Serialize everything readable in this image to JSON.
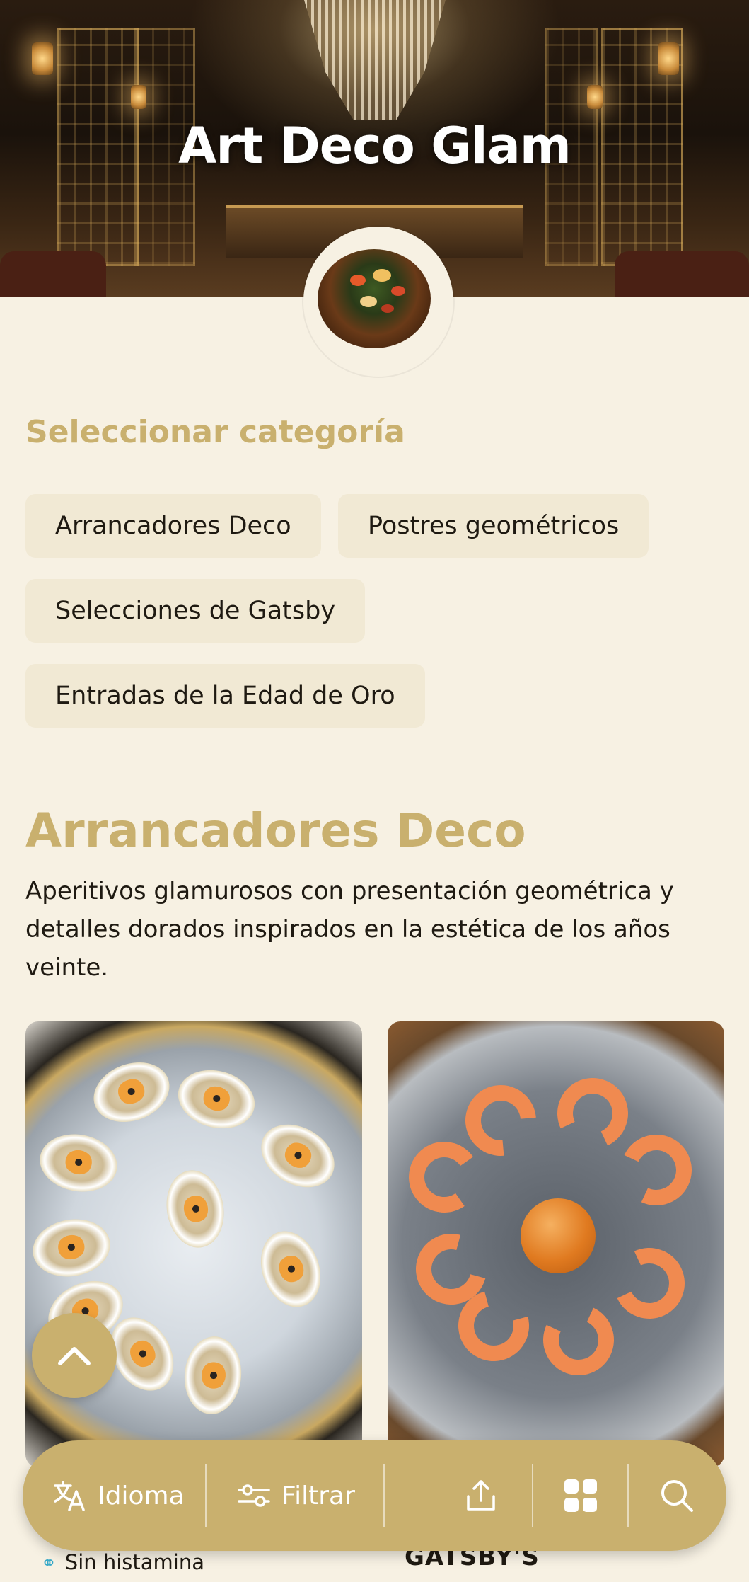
{
  "restaurant": {
    "name": "Art Deco Glam"
  },
  "categories": {
    "heading": "Seleccionar categoría",
    "items": [
      "Arrancadores Deco",
      "Postres geométricos",
      "Selecciones de Gatsby",
      "Entradas de la Edad de Oro"
    ]
  },
  "section": {
    "title": "Arrancadores Deco",
    "description": "Aperitivos glamurosos con presentación geométrica y detalles dorados inspirados en la estética de los años veinte."
  },
  "cards": [
    {
      "tag": "Sin histamina",
      "tag_icon": "histamine-free-icon"
    },
    {
      "title": "GATSBY'S"
    }
  ],
  "nav": {
    "language_label": "Idioma",
    "filter_label": "Filtrar",
    "icons": [
      "translate-icon",
      "filter-sliders-icon",
      "share-icon",
      "grid-view-icon",
      "search-icon"
    ]
  },
  "fab": {
    "icon": "chevron-up-icon"
  },
  "colors": {
    "accent": "#c9b06e",
    "background": "#f7f1e3",
    "chip": "#f1e9d4"
  }
}
